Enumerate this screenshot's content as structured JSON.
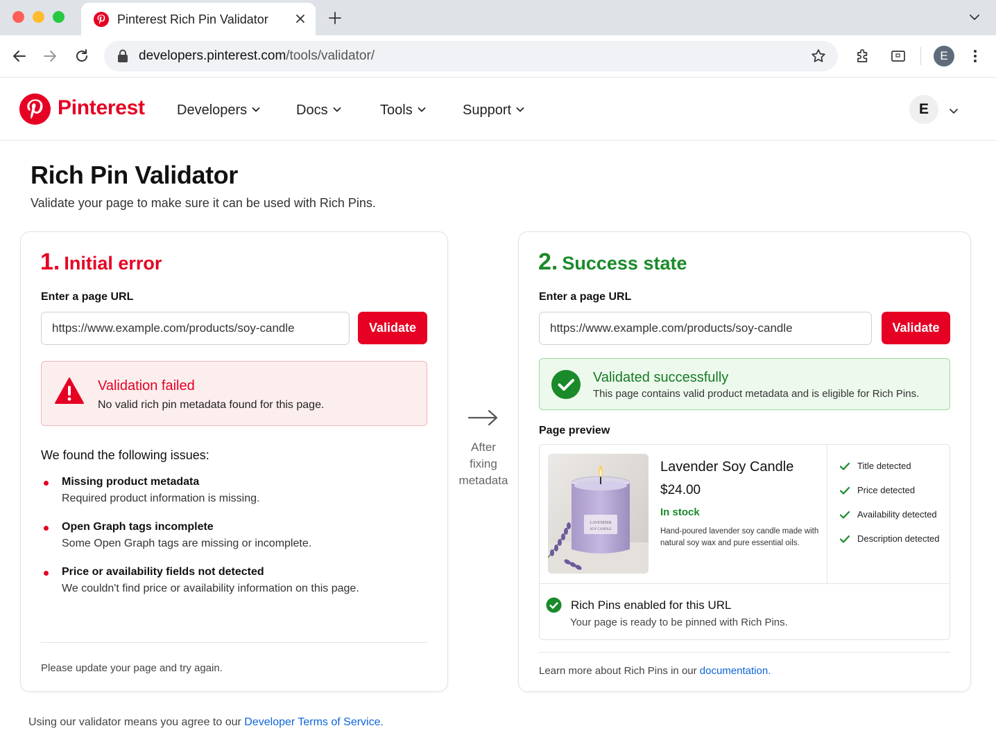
{
  "browser": {
    "tab_title": "Pinterest Rich Pin Validator",
    "url_host": "developers.pinterest.com",
    "url_path": "/tools/validator/",
    "profile_initial": "E"
  },
  "site": {
    "logo_text": "Pinterest",
    "nav": [
      "Developers",
      "Docs",
      "Tools",
      "Support"
    ],
    "user_initial": "E"
  },
  "page": {
    "title": "Rich Pin Validator",
    "subtitle": "Validate your page to make sure it can be used with Rich Pins."
  },
  "left_panel": {
    "step_num": "1.",
    "step_label": "Initial error",
    "field_label": "Enter a page URL",
    "url_value": "https://www.example.com/products/soy-candle",
    "validate_label": "Validate",
    "error_title": "Validation failed",
    "error_msg": "No valid rich pin metadata found for this page.",
    "issues_heading": "We found the following issues:",
    "issues": [
      {
        "title": "Missing product metadata",
        "desc": "Required product information is missing."
      },
      {
        "title": "Open Graph tags incomplete",
        "desc": "Some Open Graph tags are missing or incomplete."
      },
      {
        "title": "Price or availability fields not detected",
        "desc": "We couldn't find price or availability information on this page."
      }
    ],
    "footer_note": "Please update your page and try again."
  },
  "middle": {
    "caption_lines": [
      "After",
      "fixing",
      "metadata"
    ]
  },
  "right_panel": {
    "step_num": "2.",
    "step_label": "Success state",
    "field_label": "Enter a page URL",
    "url_value": "https://www.example.com/products/soy-candle",
    "validate_label": "Validate",
    "success_title": "Validated successfully",
    "success_msg": "This page contains valid product metadata and is eligible for Rich Pins.",
    "preview_label": "Page preview",
    "product": {
      "name": "Lavender Soy Candle",
      "price": "$24.00",
      "stock": "In stock",
      "description": "Hand-poured lavender soy candle made with natural soy wax and pure essential oils.",
      "jar_label_1": "LAVENDER",
      "jar_label_2": "SOY CANDLE"
    },
    "detections": [
      "Title detected",
      "Price detected",
      "Availability detected",
      "Description detected"
    ],
    "enabled_title": "Rich Pins enabled for this URL",
    "enabled_msg": "Your page is ready to be pinned with Rich Pins.",
    "learn_more_prefix": "Learn more about Rich Pins in our ",
    "learn_more_link": "documentation."
  },
  "footer": {
    "prefix": "Using our validator means you agree to our ",
    "link": "Developer Terms of Service."
  },
  "colors": {
    "brand_red": "#e60023",
    "success_green": "#1a8a2a",
    "link_blue": "#0b64d9"
  }
}
